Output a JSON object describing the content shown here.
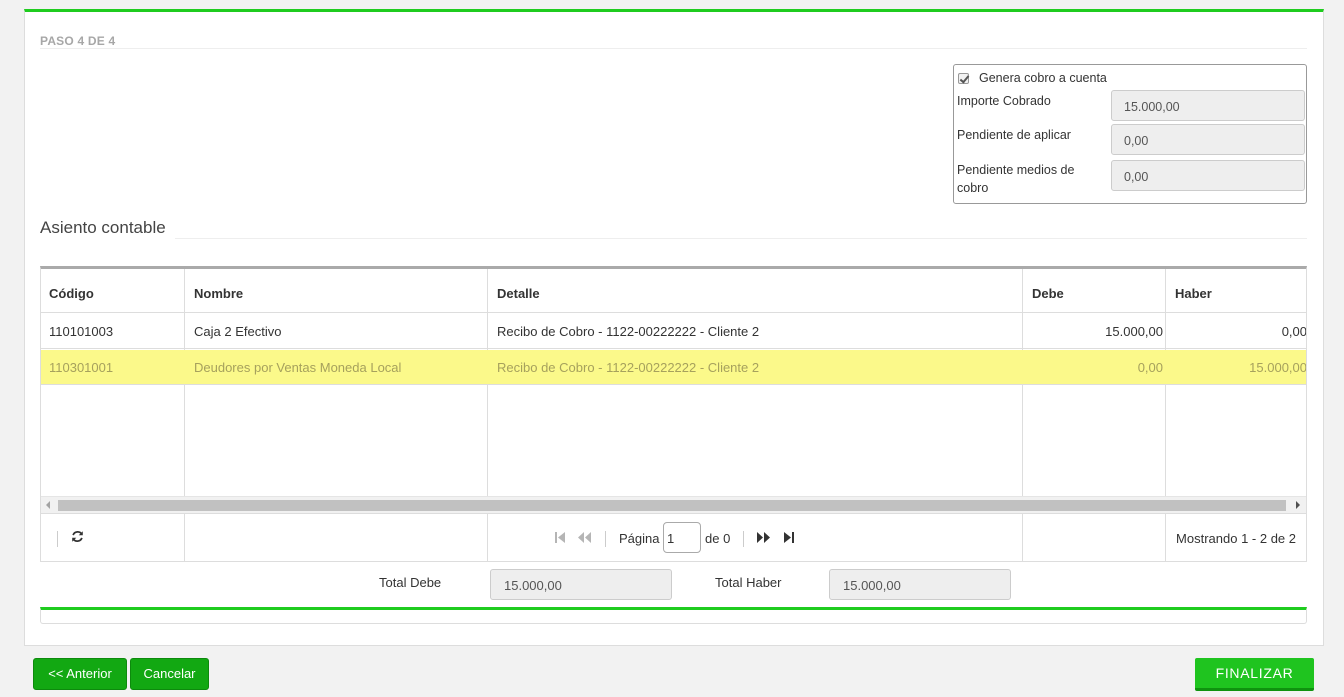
{
  "wizard": {
    "step_label": "PASO 4 DE 4"
  },
  "cobro": {
    "checkbox_label": "Genera cobro a cuenta",
    "checked": true,
    "fields": [
      {
        "label": "Importe Cobrado",
        "value": "15.000,00"
      },
      {
        "label": "Pendiente de aplicar",
        "value": "0,00"
      },
      {
        "label": "Pendiente medios de cobro",
        "value": "0,00"
      }
    ]
  },
  "asiento": {
    "title": "Asiento contable",
    "columns": [
      "Código",
      "Nombre",
      "Detalle",
      "Debe",
      "Haber"
    ],
    "rows": [
      {
        "codigo": "110101003",
        "nombre": "Caja 2 Efectivo",
        "detalle": "Recibo de Cobro - 1122-00222222 - Cliente 2",
        "debe": "15.000,00",
        "haber": "0,00",
        "selected": false
      },
      {
        "codigo": "110301001",
        "nombre": "Deudores por Ventas Moneda Local",
        "detalle": "Recibo de Cobro - 1122-00222222 - Cliente 2",
        "debe": "0,00",
        "haber": "15.000,00",
        "selected": true
      }
    ],
    "pager": {
      "page_label": "Página",
      "page_value": "1",
      "of_label": "de 0",
      "status": "Mostrando 1 - 2 de 2"
    }
  },
  "totals": {
    "debe_label": "Total Debe",
    "debe_value": "15.000,00",
    "haber_label": "Total Haber",
    "haber_value": "15.000,00"
  },
  "actions": {
    "prev_label": "<< Anterior",
    "cancel_label": "Cancelar",
    "finish_label": "FINALIZAR"
  },
  "colors": {
    "accent": "#1fcc1f",
    "selected_row": "#fbf98a",
    "button": "#12a812"
  }
}
